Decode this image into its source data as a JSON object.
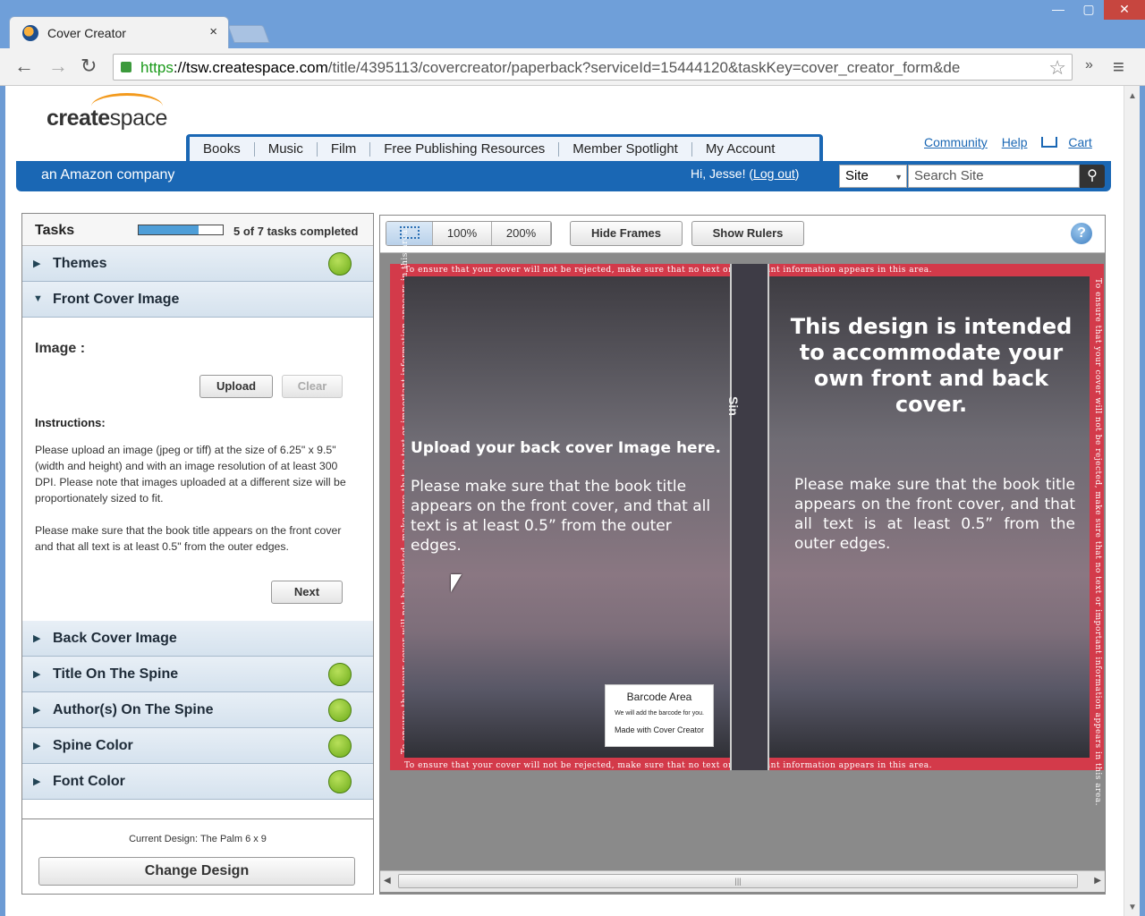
{
  "browser": {
    "tab_title": "Cover Creator",
    "tab_close": "×",
    "url_https": "https",
    "url_host": "://tsw.createspace.com",
    "url_path": "/title/4395113/covercreator/paperback?serviceId=15444120&taskKey=cover_creator_form&de",
    "icons": [
      "back-icon",
      "forward-icon",
      "reload-icon",
      "lock-icon",
      "star-icon",
      "menu-icon"
    ]
  },
  "header": {
    "logo_bold": "create",
    "logo_rest": "space",
    "tagline": "an Amazon company",
    "nav": [
      "Books",
      "Music",
      "Film",
      "Free Publishing Resources",
      "Member Spotlight",
      "My Account"
    ],
    "links": {
      "community": "Community",
      "help": "Help",
      "cart": "Cart"
    },
    "greeting": "Hi, Jesse!",
    "logout": "Log out",
    "site_select": "Site",
    "search_placeholder": "Search Site"
  },
  "tasks": {
    "title": "Tasks",
    "progress_fraction": 0.71,
    "completed_text": "5 of 7 tasks completed",
    "items": [
      {
        "label": "Themes",
        "done": true,
        "expanded": false
      },
      {
        "label": "Front Cover Image",
        "done": false,
        "expanded": true
      },
      {
        "label": "Back Cover Image",
        "done": false,
        "expanded": false
      },
      {
        "label": "Title On The Spine",
        "done": true,
        "expanded": false
      },
      {
        "label": "Author(s) On The Spine",
        "done": true,
        "expanded": false
      },
      {
        "label": "Spine Color",
        "done": true,
        "expanded": false
      },
      {
        "label": "Font Color",
        "done": true,
        "expanded": false
      }
    ],
    "panel": {
      "image_label": "Image :",
      "upload": "Upload",
      "clear": "Clear",
      "instructions_heading": "Instructions:",
      "instructions_p1": "Please upload an image (jpeg or tiff) at the size of 6.25\" x 9.5\" (width and height) and with an image resolution of at least 300 DPI. Please note that images uploaded at a different size will be proportionately sized to fit.",
      "instructions_p2": "Please make sure that the book title appears on the front cover and that all text is at least 0.5\" from the outer edges.",
      "next": "Next"
    },
    "current_design": "Current Design: The Palm 6 x 9",
    "change_design": "Change Design"
  },
  "viewer": {
    "zoom_100": "100%",
    "zoom_200": "200%",
    "hide_frames": "Hide Frames",
    "show_rulers": "Show Rulers",
    "help": "?",
    "bleed_text": "To ensure that your cover will not be rejected, make sure that no text or important information appears in this area.",
    "spine_text": "Sin",
    "back_heading": "Upload your back cover Image here.",
    "back_body": "Please make sure that the book title appears on the front cover, and that all text is at least 0.5” from the outer edges.",
    "front_heading": "This design is intended to accommodate your own front and back cover.",
    "front_body": "Please make sure that the book title appears on the front cover, and that all text is at least 0.5” from the outer edges.",
    "barcode_title": "Barcode Area",
    "barcode_note": "We will add the barcode for you.",
    "barcode_made": "Made with Cover Creator"
  },
  "colors": {
    "brand_blue": "#1a67b4",
    "bleed_red": "#d33a4a",
    "done_green": "#7fbf2a"
  }
}
